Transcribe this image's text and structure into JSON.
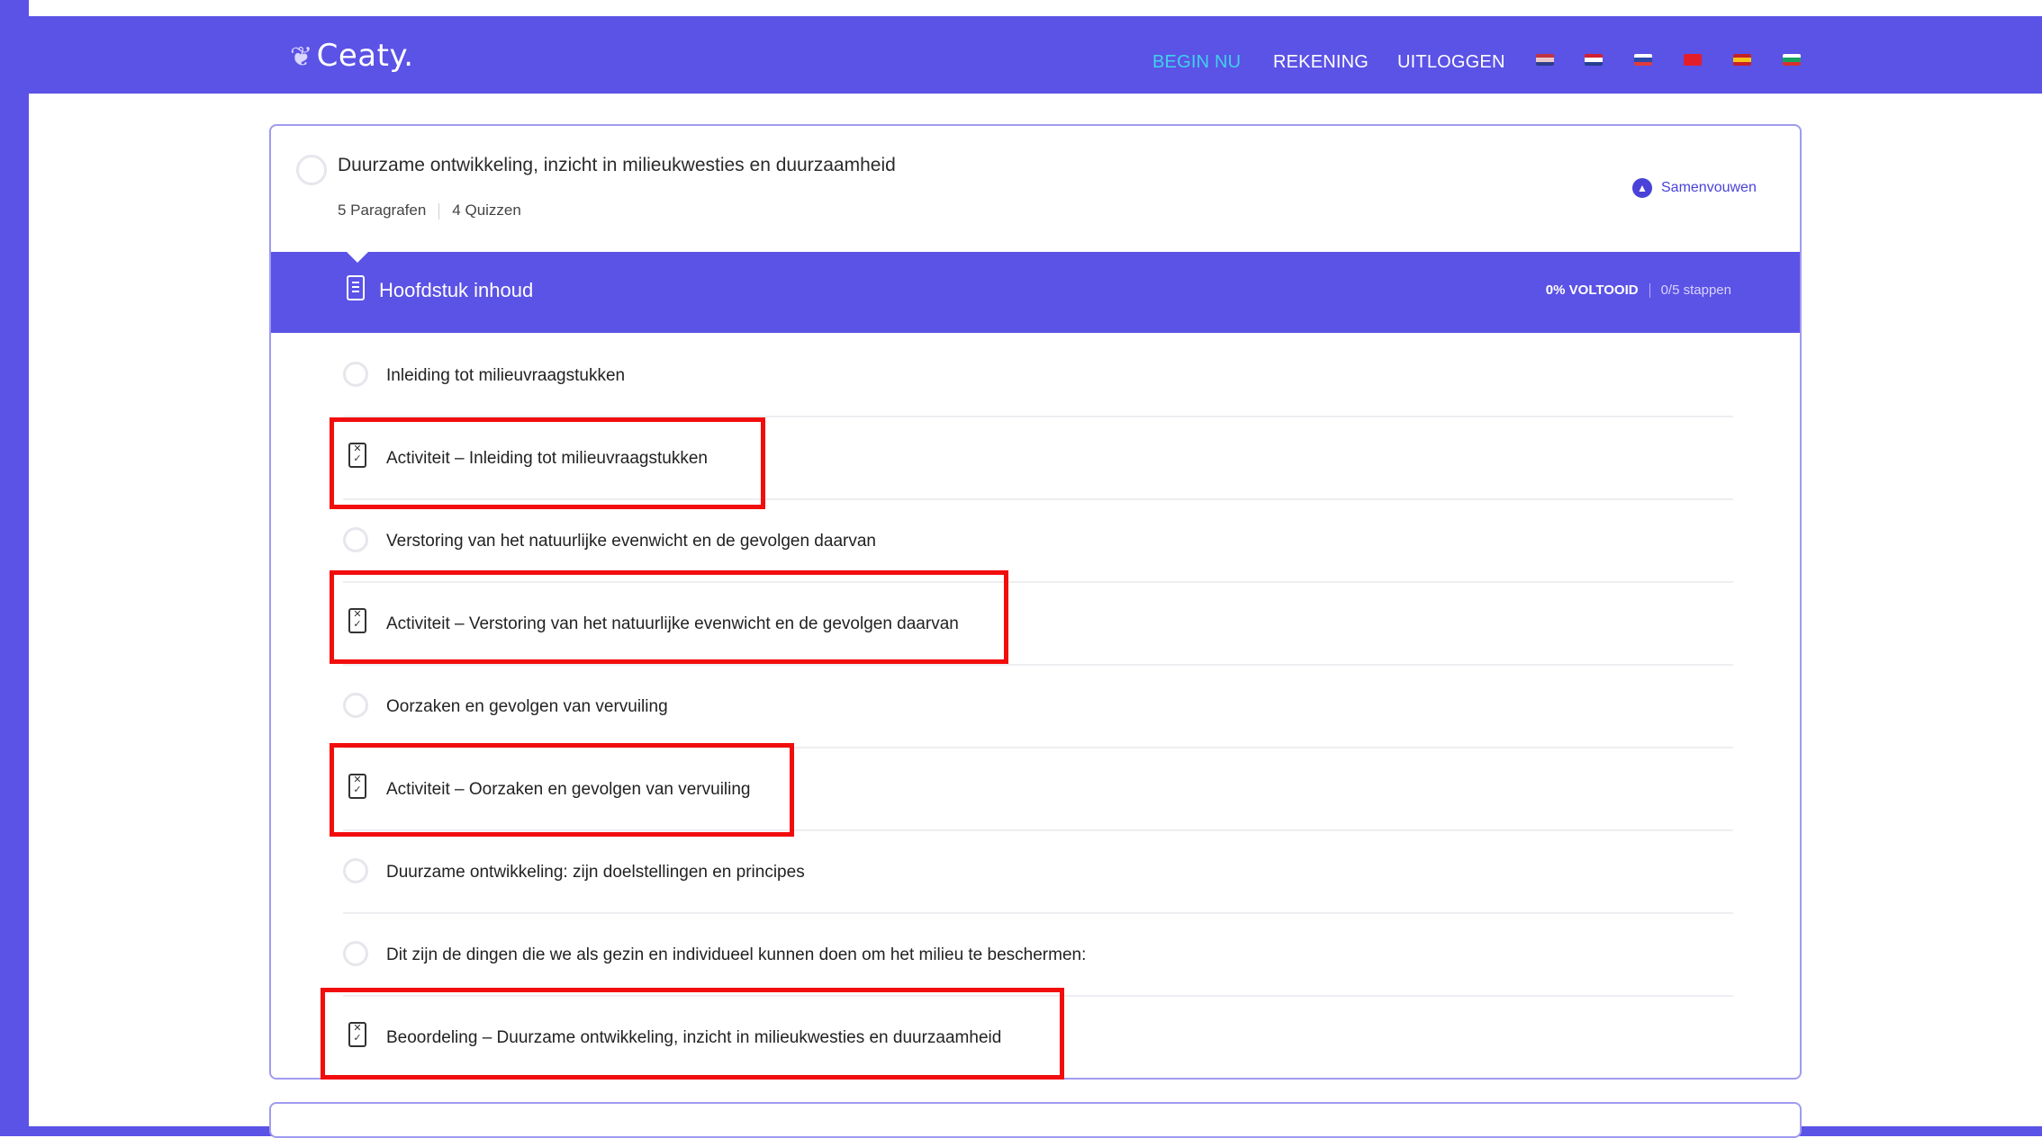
{
  "header": {
    "logo": "Ceaty.",
    "nav": [
      {
        "label": "BEGIN NU",
        "active": true
      },
      {
        "label": "REKENING",
        "active": false
      },
      {
        "label": "UITLOGGEN",
        "active": false
      }
    ],
    "flags": [
      "flag-uk-icon",
      "flag-nl-icon",
      "flag-sk-icon",
      "flag-tr-icon",
      "flag-es-icon",
      "flag-bg-icon"
    ],
    "accent": "#5b52e6",
    "active_color": "#3fd2ea"
  },
  "topic": {
    "title": "Duurzame ontwikkeling, inzicht in milieukwesties en duurzaamheid",
    "paragraphs": "5 Paragrafen",
    "quizzes": "4 Quizzen",
    "collapse_label": "Samenvouwen"
  },
  "content": {
    "title": "Hoofdstuk inhoud",
    "progress": "0% VOLTOOID",
    "steps": "0/5 stappen",
    "items": [
      {
        "label": "Inleiding tot milieuvraagstukken",
        "type": "lesson",
        "highlighted": false
      },
      {
        "label": "Activiteit – Inleiding tot milieuvraagstukken",
        "type": "quiz",
        "highlighted": true
      },
      {
        "label": "Verstoring van het natuurlijke evenwicht en de gevolgen daarvan",
        "type": "lesson",
        "highlighted": false
      },
      {
        "label": "Activiteit – Verstoring van het natuurlijke evenwicht en de gevolgen daarvan",
        "type": "quiz",
        "highlighted": true
      },
      {
        "label": "Oorzaken en gevolgen van vervuiling",
        "type": "lesson",
        "highlighted": false
      },
      {
        "label": "Activiteit – Oorzaken en gevolgen van vervuiling",
        "type": "quiz",
        "highlighted": true
      },
      {
        "label": "Duurzame ontwikkeling: zijn doelstellingen en principes",
        "type": "lesson",
        "highlighted": false
      },
      {
        "label": "Dit zijn de dingen die we als gezin en individueel kunnen doen om het milieu te beschermen:",
        "type": "lesson",
        "highlighted": false
      },
      {
        "label": "Beoordeling – Duurzame ontwikkeling, inzicht in milieukwesties en duurzaamheid",
        "type": "quiz",
        "highlighted": true
      }
    ]
  },
  "highlight_color": "#f20d0d"
}
